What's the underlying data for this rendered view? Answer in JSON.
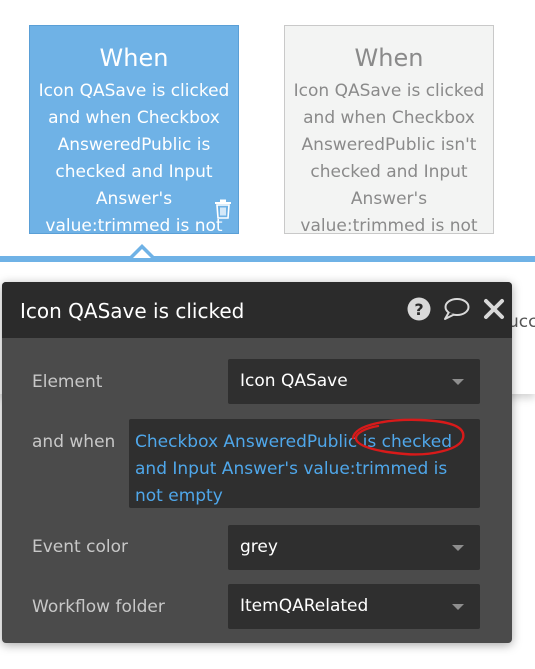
{
  "cards": [
    {
      "title": "When",
      "description": "Icon QASave is clicked and when Checkbox AnsweredPublic is checked and Input Answer's value:trimmed is not",
      "state": "selected"
    },
    {
      "title": "When",
      "description": "Icon QASave is clicked and when Checkbox AnsweredPublic isn't checked and Input Answer's value:trimmed is not",
      "state": "unselected"
    }
  ],
  "background_clipped_text": "ucc",
  "panel": {
    "title": "Icon QASave is clicked",
    "header_icons": [
      "help-icon",
      "comment-icon",
      "close-icon"
    ],
    "element": {
      "label": "Element",
      "value": "Icon QASave"
    },
    "and_when": {
      "label": "and when",
      "expression": "Checkbox AnsweredPublic is checked and Input Answer's value:trimmed is not empty"
    },
    "event_color": {
      "label": "Event color",
      "value": "grey"
    },
    "workflow_folder": {
      "label": "Workflow folder",
      "value": "ItemQARelated"
    }
  },
  "colors": {
    "selected_card": "#6fb2e6",
    "panel_bg": "#4b4b4b",
    "panel_header": "#2b2b2b",
    "expression_text": "#4fa7ea",
    "annotation": "#d81a1a"
  }
}
